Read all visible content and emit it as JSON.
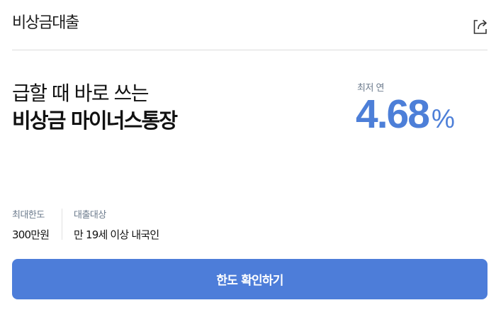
{
  "header": {
    "title": "비상금대출",
    "share_icon": "share-icon"
  },
  "hero": {
    "headline_line1": "급할 때 바로 쓰는",
    "headline_line2": "비상금 마이너스통장"
  },
  "rate": {
    "label": "최저 연",
    "value": "4.68",
    "unit": "%",
    "color": "#4d7fd8"
  },
  "info": [
    {
      "label": "최대한도",
      "value": "300만원"
    },
    {
      "label": "대출대상",
      "value": "만 19세 이상 내국인"
    }
  ],
  "cta": {
    "label": "한도 확인하기",
    "color": "#4d7dd9"
  }
}
